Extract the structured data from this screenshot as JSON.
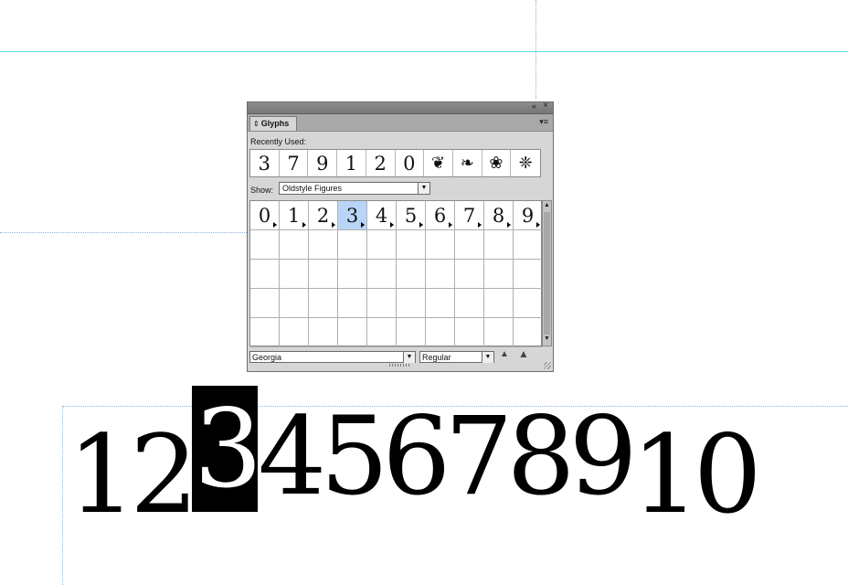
{
  "panel": {
    "tab_label": "Glyphs",
    "recent_label": "Recently Used:",
    "recent_glyphs": [
      "3",
      "7",
      "9",
      "1",
      "2",
      "0",
      "❦",
      "❧",
      "❀",
      "❈"
    ],
    "show_label": "Show:",
    "show_value": "Oldstyle Figures",
    "glyph_grid": [
      "0",
      "1",
      "2",
      "3",
      "4",
      "5",
      "6",
      "7",
      "8",
      "9"
    ],
    "selected_glyph_index": 3,
    "font_value": "Georgia",
    "style_value": "Regular"
  },
  "document": {
    "text_chars": [
      "1",
      "2",
      "3",
      "4",
      "5",
      "6",
      "7",
      "8",
      "9",
      "1",
      "0"
    ],
    "selected_char_index": 2
  },
  "icons": {
    "collapse": "«",
    "close": "×",
    "menu": "▾≡",
    "dropdown": "▼",
    "scroll_up": "▲",
    "scroll_down": "▼",
    "zoom_out": "▲",
    "zoom_in": "▲"
  }
}
